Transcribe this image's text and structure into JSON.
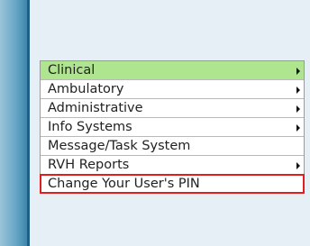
{
  "menu": {
    "items": [
      {
        "label": "Clinical",
        "has_submenu": true,
        "active": true
      },
      {
        "label": "Ambulatory",
        "has_submenu": true
      },
      {
        "label": "Administrative",
        "has_submenu": true
      },
      {
        "label": "Info Systems",
        "has_submenu": true
      },
      {
        "label": "Message/Task System",
        "has_submenu": false
      },
      {
        "label": "RVH Reports",
        "has_submenu": true
      },
      {
        "label": "Change Your User's PIN",
        "has_submenu": false,
        "highlighted": true
      }
    ]
  },
  "colors": {
    "active_item": "#aee58e",
    "highlight_border": "#e01e1e",
    "sidebar": "#3e86ad",
    "panel": "#e6eef6"
  }
}
